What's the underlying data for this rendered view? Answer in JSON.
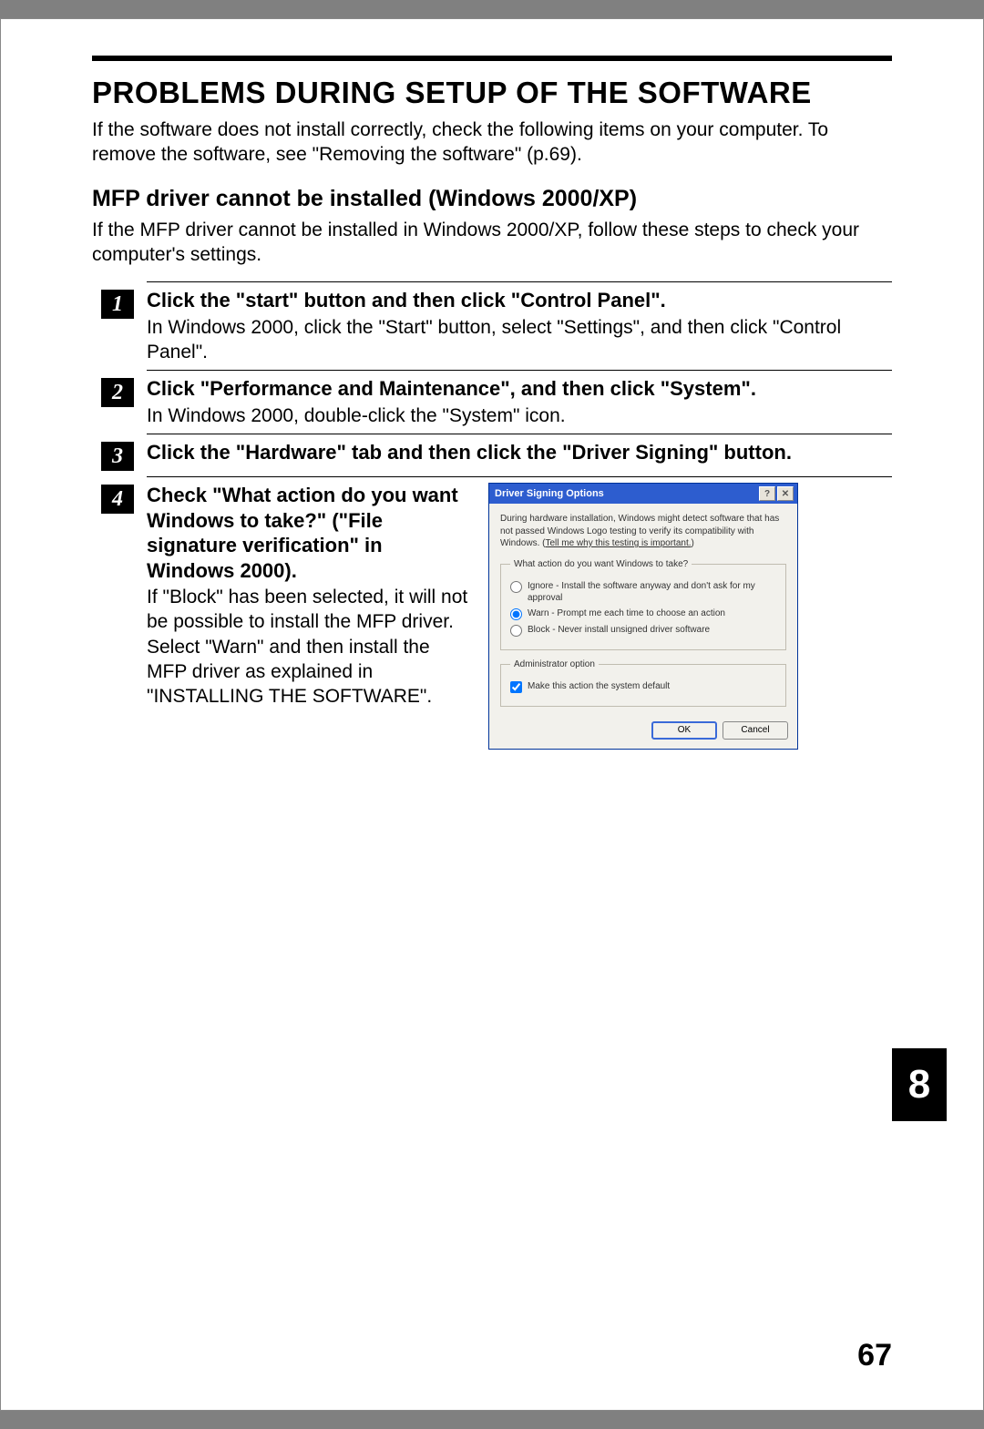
{
  "heading": "PROBLEMS DURING SETUP OF THE SOFTWARE",
  "intro": "If the software does not install correctly, check the following items on your computer. To remove the software, see \"Removing the software\" (p.69).",
  "subheading": "MFP driver cannot be installed (Windows 2000/XP)",
  "subintro": "If the MFP driver cannot be installed in Windows 2000/XP, follow these steps to check your computer's settings.",
  "steps": [
    {
      "num": "1",
      "title": "Click the \"start\" button and then click \"Control Panel\".",
      "desc": "In Windows 2000, click the \"Start\" button, select \"Settings\", and then click \"Control Panel\"."
    },
    {
      "num": "2",
      "title": "Click \"Performance and Maintenance\", and then click \"System\".",
      "desc": "In Windows 2000, double-click the \"System\" icon."
    },
    {
      "num": "3",
      "title": "Click the \"Hardware\" tab and then click the \"Driver Signing\" button.",
      "desc": ""
    },
    {
      "num": "4",
      "title": "Check \"What action do you want Windows to take?\" (\"File signature verification\" in Windows 2000).",
      "desc": "If \"Block\" has been selected, it will not be possible to install the MFP driver. Select \"Warn\" and then install the MFP driver as explained in \"INSTALLING THE SOFTWARE\"."
    }
  ],
  "dialog": {
    "title": "Driver Signing Options",
    "help_icon": "?",
    "close_icon": "✕",
    "body_text_pre": "During hardware installation, Windows might detect software that has not passed Windows Logo testing to verify its compatibility with Windows. (",
    "body_link": "Tell me why this testing is important.",
    "body_text_post": ")",
    "group1_legend": "What action do you want Windows to take?",
    "radio_ignore": "Ignore - Install the software anyway and don't ask for my approval",
    "radio_warn": "Warn - Prompt me each time to choose an action",
    "radio_block": "Block - Never install unsigned driver software",
    "group2_legend": "Administrator option",
    "checkbox_label": "Make this action the system default",
    "ok_label": "OK",
    "cancel_label": "Cancel"
  },
  "chapter_tab": "8",
  "page_number": "67"
}
